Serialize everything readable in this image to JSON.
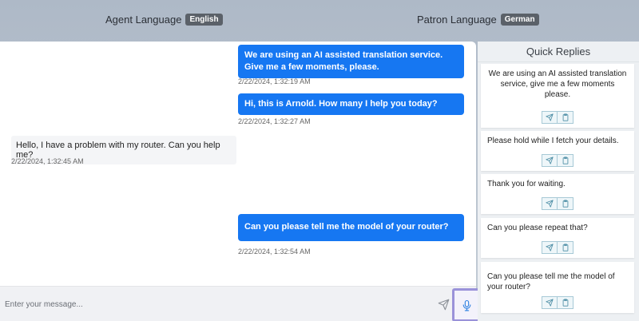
{
  "header": {
    "agent_language_label": "Agent Language",
    "agent_language_value": "English",
    "patron_language_label": "Patron Language",
    "patron_language_value": "German"
  },
  "messages": [
    {
      "direction": "outgoing",
      "text": "We are using an AI assisted translation service. Give me a few moments, please.",
      "timestamp": "2/22/2024, 1:32:19 AM"
    },
    {
      "direction": "outgoing",
      "text": "Hi, this is Arnold. How many I help you today?",
      "timestamp": "2/22/2024, 1:32:27 AM"
    },
    {
      "direction": "incoming",
      "text": "Hello, I have a problem with my router. Can you help me?",
      "timestamp": "2/22/2024, 1:32:45 AM"
    },
    {
      "direction": "outgoing",
      "text": "Can you please tell me the model of your router?",
      "timestamp": "2/22/2024, 1:32:54 AM"
    }
  ],
  "composer": {
    "placeholder": "Enter your message...",
    "send_icon": "send-icon",
    "mic_icon": "microphone-icon"
  },
  "quick_replies": {
    "title": "Quick Replies",
    "items": [
      "We are using an AI assisted translation service, give me a few moments please.",
      "Please hold while I fetch your details.",
      "Thank you for waiting.",
      "Can you please repeat that?",
      "Can you please tell me the model of your router?"
    ],
    "action_icons": [
      "send-icon",
      "clipboard-icon"
    ]
  },
  "colors": {
    "accent": "#1677f2",
    "mic_highlight": "#9a92d9"
  }
}
